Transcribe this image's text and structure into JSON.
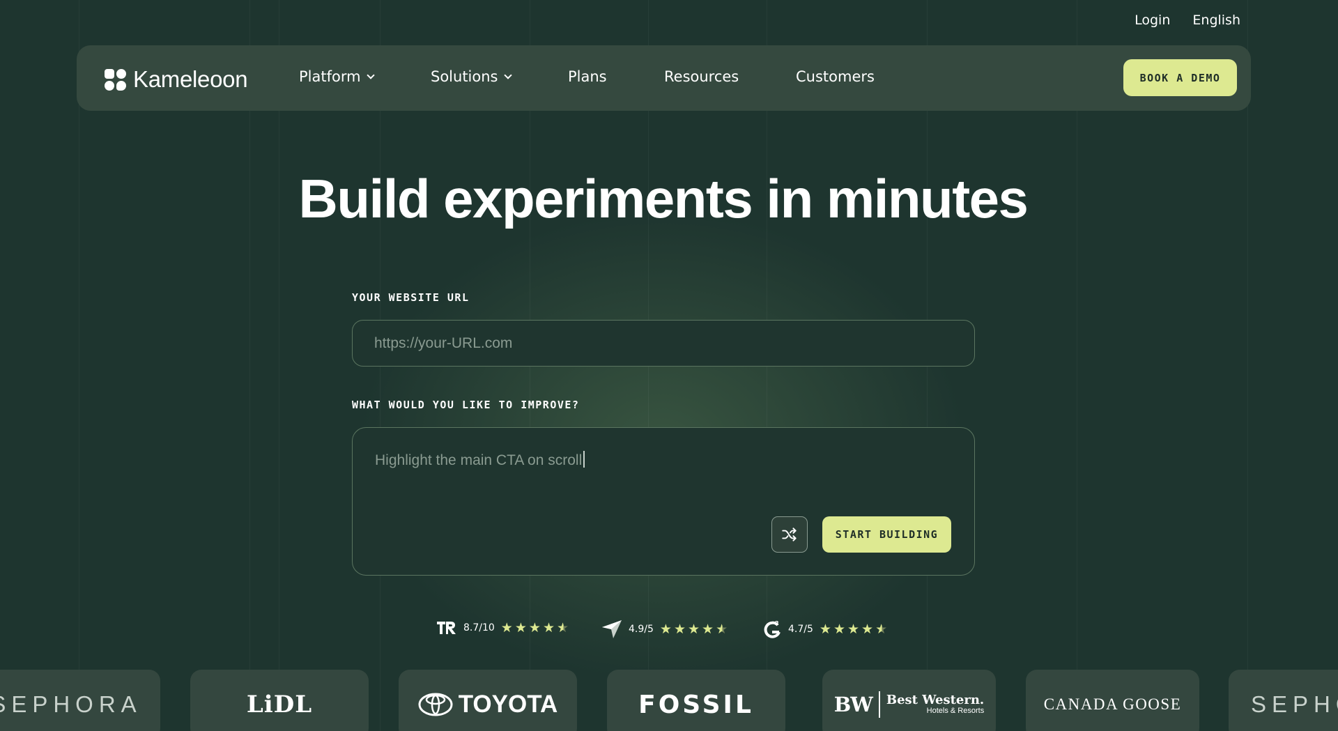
{
  "utility_nav": {
    "login": "Login",
    "language": "English"
  },
  "nav": {
    "brand": "Kameleoon",
    "items": [
      {
        "label": "Platform",
        "dropdown": true
      },
      {
        "label": "Solutions",
        "dropdown": true
      },
      {
        "label": "Plans",
        "dropdown": false
      },
      {
        "label": "Resources",
        "dropdown": false
      },
      {
        "label": "Customers",
        "dropdown": false
      }
    ],
    "cta": "BOOK A DEMO"
  },
  "hero": {
    "title": "Build experiments in minutes",
    "url_label": "YOUR WEBSITE URL",
    "url_placeholder": "https://your-URL.com",
    "improve_label": "WHAT WOULD YOU LIKE TO IMPROVE?",
    "improve_value": "Highlight the main CTA on scroll",
    "shuffle_icon": "shuffle-icon",
    "start_button": "START BUILDING"
  },
  "ratings": [
    {
      "source_icon": "trustradius-icon",
      "score": "8.7/10",
      "stars": 4.5
    },
    {
      "source_icon": "capterra-icon",
      "score": "4.9/5",
      "stars": 4.5
    },
    {
      "source_icon": "g2-icon",
      "score": "4.7/5",
      "stars": 4.5
    }
  ],
  "customer_logos": {
    "sephora": "SEPHORA",
    "lidl": "LiDL",
    "toyota": "TOYOTA",
    "fossil": "FOSSIL",
    "best_western_mark": "BW",
    "best_western_name": "Best Western.",
    "best_western_sub": "Hotels & Resorts",
    "canada_goose": "CANADA GOOSE",
    "sephora_repeat": "SEPHO"
  },
  "colors": {
    "background": "#1e352f",
    "nav_background": "#35493f",
    "accent": "#dde991",
    "star": "#dde991"
  }
}
